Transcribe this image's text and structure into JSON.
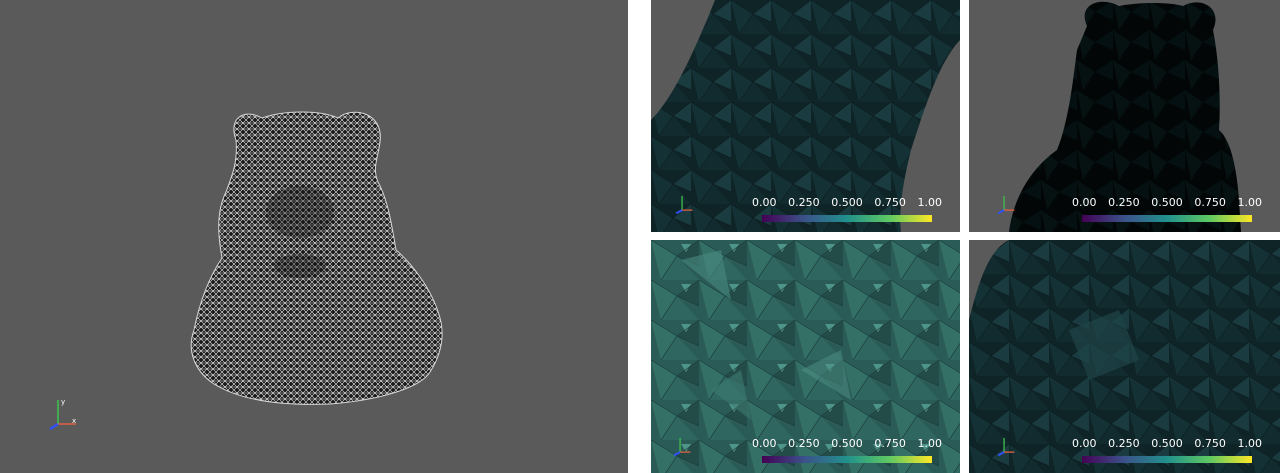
{
  "main_view": {
    "axes": {
      "x_label": "x",
      "y_label": "y"
    }
  },
  "colorbar": {
    "ticks": [
      "0.00",
      "0.250",
      "0.500",
      "0.750",
      "1.00"
    ],
    "colormap": "viridis"
  },
  "colors": {
    "background": "#5a5a5a",
    "mesh_wire": "#ffffff",
    "mesh_surface": "#2c5b55"
  },
  "views": [
    {
      "id": "tl"
    },
    {
      "id": "tr"
    },
    {
      "id": "bl"
    },
    {
      "id": "br"
    }
  ]
}
